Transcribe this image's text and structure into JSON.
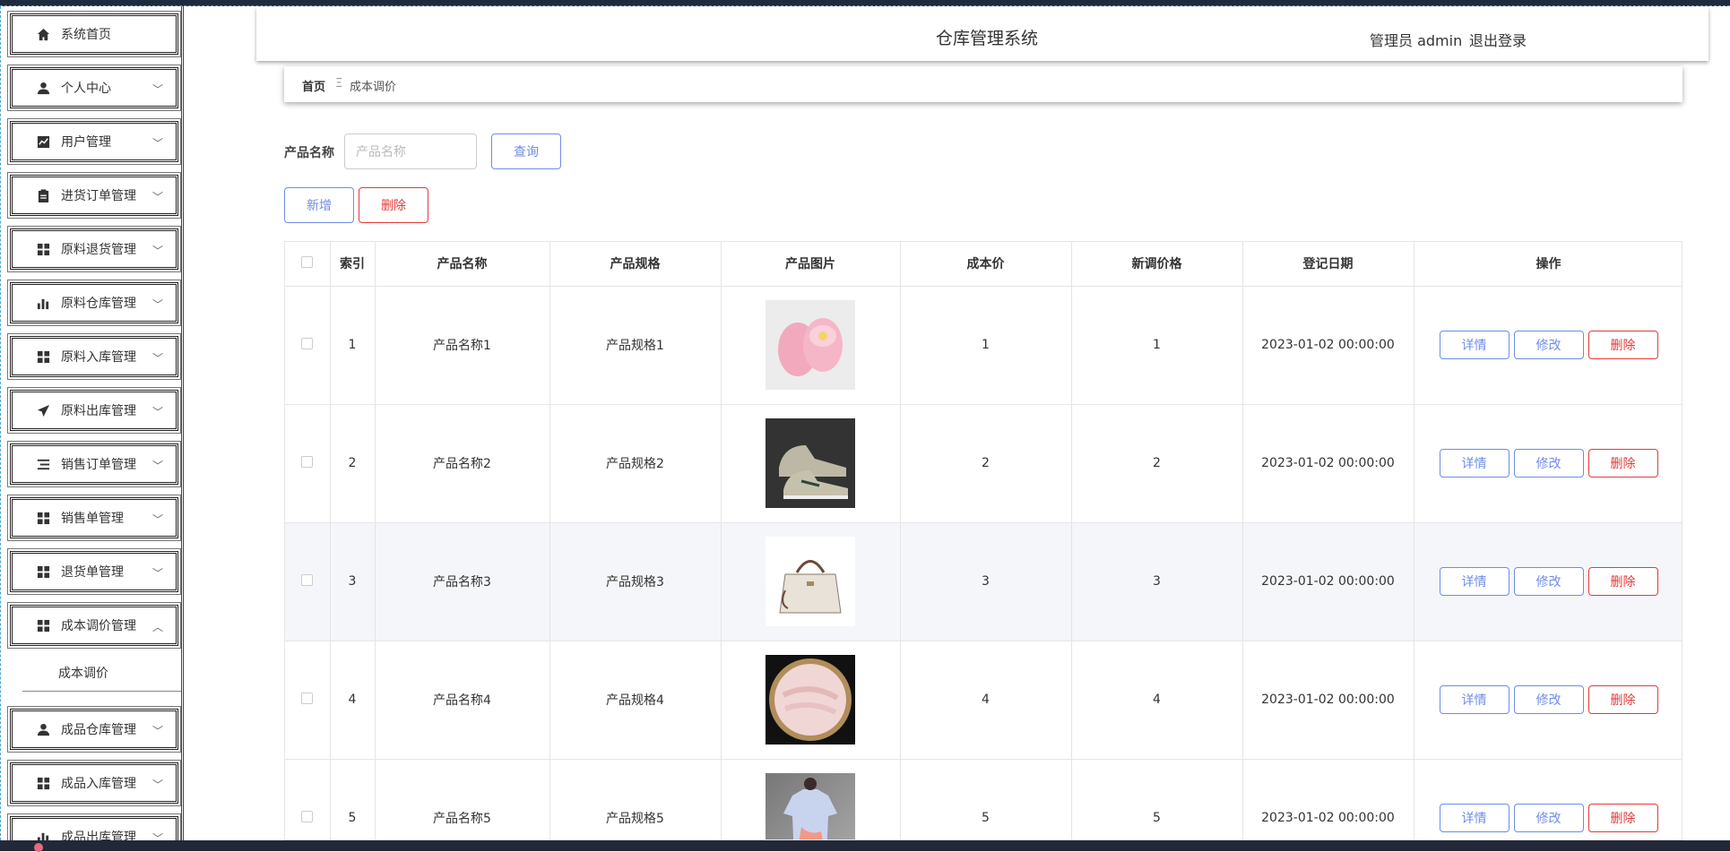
{
  "app_title": "仓库管理系统",
  "header": {
    "user_label": "管理员 admin",
    "logout_label": "退出登录"
  },
  "sidebar": {
    "items": [
      {
        "label": "系统首页",
        "icon": "home-icon",
        "chevron": ""
      },
      {
        "label": "个人中心",
        "icon": "user-icon",
        "chevron": "﹀"
      },
      {
        "label": "用户管理",
        "icon": "chart-line-icon",
        "chevron": "﹀"
      },
      {
        "label": "进货订单管理",
        "icon": "clipboard-icon",
        "chevron": "﹀"
      },
      {
        "label": "原料退货管理",
        "icon": "grid-icon",
        "chevron": "﹀"
      },
      {
        "label": "原料仓库管理",
        "icon": "bar-chart-icon",
        "chevron": "﹀"
      },
      {
        "label": "原料入库管理",
        "icon": "grid-icon",
        "chevron": "﹀"
      },
      {
        "label": "原料出库管理",
        "icon": "send-icon",
        "chevron": "﹀"
      },
      {
        "label": "销售订单管理",
        "icon": "list-icon",
        "chevron": "﹀"
      },
      {
        "label": "销售单管理",
        "icon": "grid-icon",
        "chevron": "﹀"
      },
      {
        "label": "退货单管理",
        "icon": "grid-icon",
        "chevron": "﹀"
      },
      {
        "label": "成本调价管理",
        "icon": "grid-icon",
        "chevron": "︿"
      }
    ],
    "submenu_label": "成本调价",
    "items_after": [
      {
        "label": "成品仓库管理",
        "icon": "user-icon",
        "chevron": "﹀"
      },
      {
        "label": "成品入库管理",
        "icon": "grid-icon",
        "chevron": "﹀"
      },
      {
        "label": "成品出库管理",
        "icon": "bar-chart-icon",
        "chevron": "﹀"
      }
    ]
  },
  "breadcrumb": {
    "home": "首页",
    "separator": "Ξ",
    "current": "成本调价"
  },
  "search": {
    "label": "产品名称",
    "placeholder": "产品名称",
    "button": "查询"
  },
  "actions": {
    "add": "新增",
    "delete": "删除"
  },
  "table": {
    "headers": [
      "索引",
      "产品名称",
      "产品规格",
      "产品图片",
      "成本价",
      "新调价格",
      "登记日期",
      "操作"
    ],
    "rows": [
      {
        "index": "1",
        "name": "产品名称1",
        "spec": "产品规格1",
        "image": "pink-slippers",
        "cost": "1",
        "new_price": "1",
        "date": "2023-01-02 00:00:00"
      },
      {
        "index": "2",
        "name": "产品名称2",
        "spec": "产品规格2",
        "image": "sneakers",
        "cost": "2",
        "new_price": "2",
        "date": "2023-01-02 00:00:00"
      },
      {
        "index": "3",
        "name": "产品名称3",
        "spec": "产品规格3",
        "image": "handbag",
        "cost": "3",
        "new_price": "3",
        "date": "2023-01-02 00:00:00"
      },
      {
        "index": "4",
        "name": "产品名称4",
        "spec": "产品规格4",
        "image": "meat-basket",
        "cost": "4",
        "new_price": "4",
        "date": "2023-01-02 00:00:00"
      },
      {
        "index": "5",
        "name": "产品名称5",
        "spec": "产品规格5",
        "image": "tshirt",
        "cost": "5",
        "new_price": "5",
        "date": "2023-01-02 00:00:00"
      }
    ],
    "row_actions": {
      "detail": "详情",
      "edit": "修改",
      "delete": "删除"
    }
  },
  "colors": {
    "accent_blue": "#6e8ce8",
    "danger_red": "#e43a3a"
  }
}
